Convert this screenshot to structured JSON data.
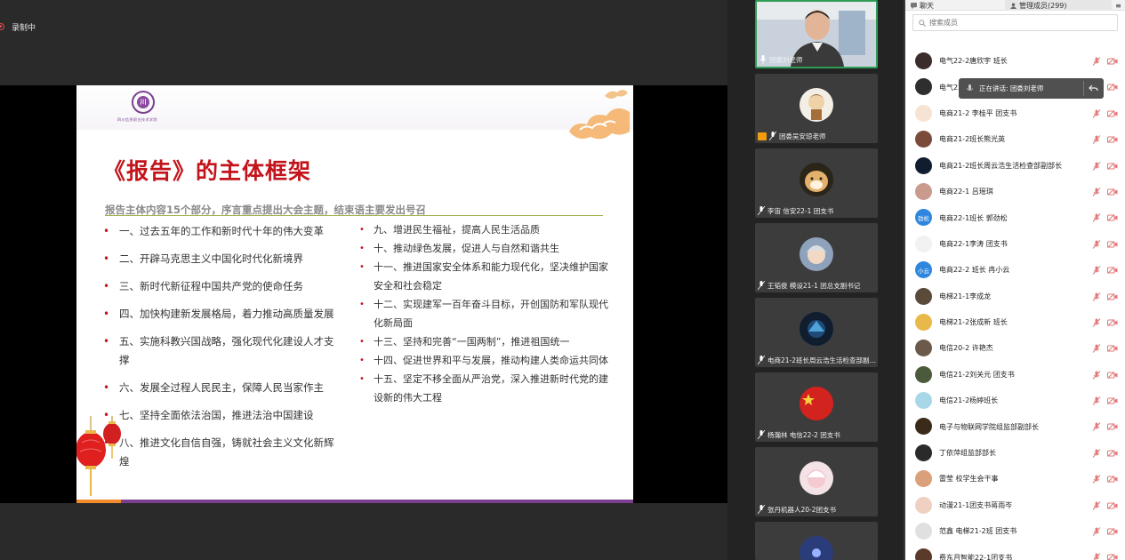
{
  "recording": {
    "label": "录制中"
  },
  "slide": {
    "school_name": "四川信息职业技术学院",
    "logo_glyph": "川",
    "title": "《报告》的主体框架",
    "subtitle": "报告主体内容15个部分，序言重点提出大会主题，结束语主要发出号召",
    "left_items": [
      "一、过去五年的工作和新时代十年的伟大变革",
      "二、开辟马克思主义中国化时代化新境界",
      "三、新时代新征程中国共产党的使命任务",
      "四、加快构建新发展格局，着力推动高质量发展",
      "五、实施科教兴国战略，强化现代化建设人才支撑",
      "六、发展全过程人民民主，保障人民当家作主",
      "七、坚持全面依法治国，推进法治中国建设",
      "八、推进文化自信自强，铸就社会主义文化新辉煌"
    ],
    "right_items": [
      "九、增进民生福祉，提高人民生活品质",
      "十、推动绿色发展，促进人与自然和谐共生",
      "十一、推进国家安全体系和能力现代化，坚决维护国家安全和社会稳定",
      "十二、实现建军一百年奋斗目标，开创国防和军队现代化新局面",
      "十三、坚持和完善“一国两制”，推进祖国统一",
      "十四、促进世界和平与发展，推动构建人类命运共同体",
      "十五、坚定不移全面从严治党，深入推进新时代党的建设新的伟大工程"
    ]
  },
  "video_tiles": [
    {
      "name": "团委刘老师",
      "active": true,
      "avatar_color": "#b9c6d4",
      "face": "#e9c2a4"
    },
    {
      "name": "团委吴安琼老师",
      "sharing": true,
      "avatar_color": "#f3efe6",
      "face": "#d8b070"
    },
    {
      "name": "李宙 信安22-1 团支书",
      "avatar_color": "#2b2418",
      "face": "#e3b16b"
    },
    {
      "name": "王韬俊 模设21-1 团总支副书记",
      "avatar_color": "#8fa2bb",
      "face": "#f1d9c6"
    },
    {
      "name": "电商21-2班长周云浩生活检查部副部长",
      "avatar_color": "#0f1d2e",
      "face": "#4fa3d9"
    },
    {
      "name": "杨瀚林 电信22-2 团支书",
      "avatar_color": "#b51e1e",
      "face": "#f3d23a"
    },
    {
      "name": "张丹机器人20-2团支书",
      "avatar_color": "#f3e3e6",
      "face": "#f4c9cf"
    },
    {
      "name": "",
      "avatar_color": "#2a3c7a",
      "face": "#9ab2ff"
    }
  ],
  "panel": {
    "tab_chat": "聊天",
    "tab_members": "管理成员(299)",
    "tab_more": "≡",
    "search_placeholder": "搜索成员",
    "speaking_tip": "正在讲话: 团委刘老师",
    "members": [
      {
        "name": "电气22-2唐欣宇 班长",
        "avatar_color": "#3b2b2b",
        "avatar_text": ""
      },
      {
        "name": "电气22-2",
        "avatar_color": "#2e2e2e",
        "avatar_text": ""
      },
      {
        "name": "电商21-2 李桂平 团支书",
        "avatar_color": "#f6e3d3",
        "avatar_text": ""
      },
      {
        "name": "电商21-2班长熊光英",
        "avatar_color": "#7a4a3a",
        "avatar_text": ""
      },
      {
        "name": "电商21-2班长周云浩生活检查部副部长",
        "avatar_color": "#0f1d2e",
        "avatar_text": ""
      },
      {
        "name": "电商22-1 吕瑶琪",
        "avatar_color": "#c99a8e",
        "avatar_text": ""
      },
      {
        "name": "电商22-1班长 郭劲松",
        "avatar_color": "#2e86de",
        "avatar_text": "劲松"
      },
      {
        "name": "电商22-1李涛 团支书",
        "avatar_color": "#f2f2f2",
        "avatar_text": ""
      },
      {
        "name": "电商22-2 班长 冉小云",
        "avatar_color": "#2e86de",
        "avatar_text": "小云"
      },
      {
        "name": "电梯21-1李成龙",
        "avatar_color": "#5a4a3a",
        "avatar_text": ""
      },
      {
        "name": "电梯21-2张成新 班长",
        "avatar_color": "#e8b84a",
        "avatar_text": ""
      },
      {
        "name": "电信20-2 许艳杰",
        "avatar_color": "#6b5a4a",
        "avatar_text": ""
      },
      {
        "name": "电信21-2刘关元 团支书",
        "avatar_color": "#4a5a3a",
        "avatar_text": ""
      },
      {
        "name": "电信21-2杨婷班长",
        "avatar_color": "#a8d8e8",
        "avatar_text": ""
      },
      {
        "name": "电子与物联网学院组监部副部长",
        "avatar_color": "#3a2a1a",
        "avatar_text": ""
      },
      {
        "name": "丁依萍组监部部长",
        "avatar_color": "#2a2a2a",
        "avatar_text": ""
      },
      {
        "name": "雷莹 校学生会干事",
        "avatar_color": "#d9a07a",
        "avatar_text": ""
      },
      {
        "name": "动漫21-1团支书蒋雨岑",
        "avatar_color": "#f0d0c0",
        "avatar_text": ""
      },
      {
        "name": "范鑫 电梯21-2班 团支书",
        "avatar_color": "#e0e0e0",
        "avatar_text": ""
      },
      {
        "name": "费东月智能22-1团支书",
        "avatar_color": "#5a3a2a",
        "avatar_text": ""
      }
    ]
  },
  "colors": {
    "title_red": "#c3141b",
    "brand_purple": "#7b3f8f",
    "active_green": "#2f9c57",
    "muted_red_icon": "#e07a7a"
  },
  "icons": [
    "record-icon",
    "microphone-icon",
    "share-screen-icon",
    "chat-icon",
    "members-icon",
    "menu-icon",
    "search-icon",
    "muted-mic-icon",
    "camera-off-icon",
    "back-arrow-icon"
  ]
}
